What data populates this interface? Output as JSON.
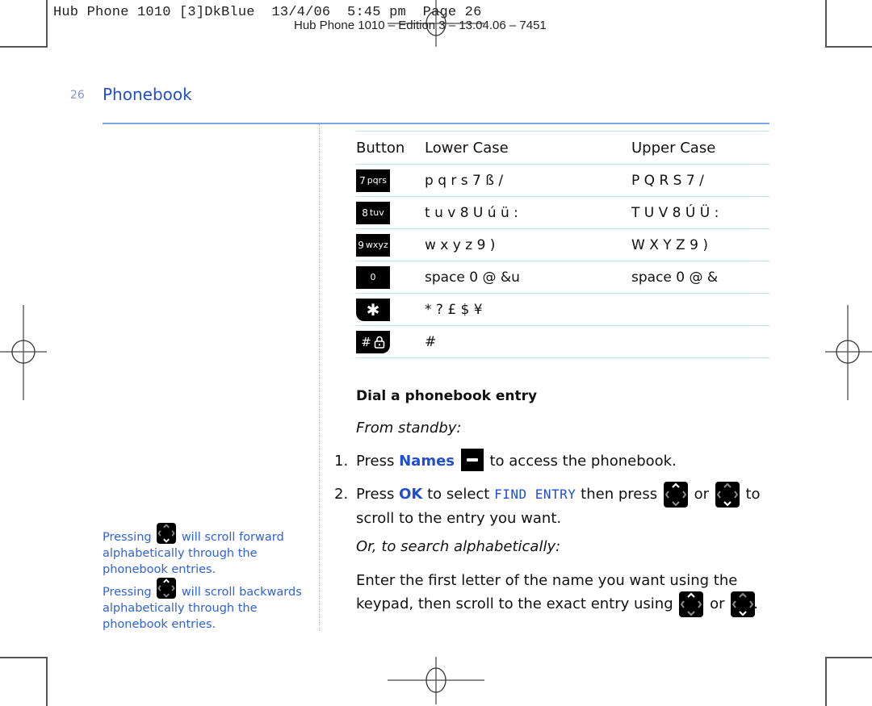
{
  "print_slug": {
    "line1": "Hub Phone 1010 [3]DkBlue  13/4/06  5:45 pm  Page 26",
    "line2": "Hub Phone 1010 – Edition 3 – 13.04.06 – 7451"
  },
  "header": {
    "page_number": "26",
    "section_title": "Phonebook"
  },
  "character_table": {
    "columns": [
      "Button",
      "Lower Case",
      "Upper Case"
    ],
    "rows": [
      {
        "key_main": "7",
        "key_sub": "pqrs",
        "lower": "p q r s 7 ß /",
        "upper": "P Q R S 7 /"
      },
      {
        "key_main": "8",
        "key_sub": "tuv",
        "lower": "t u v 8 U ú ü :",
        "upper": "T U V 8 Ú Ü :"
      },
      {
        "key_main": "9",
        "key_sub": "wxyz",
        "lower": "w x y z 9 )",
        "upper": "W X Y Z 9 )"
      },
      {
        "key_main": "0",
        "key_sub": "",
        "lower": "space 0 @ &u",
        "upper": "space 0 @ &"
      },
      {
        "key_main": "✱",
        "key_sub": "",
        "lower": "* ? £ $ ¥",
        "upper": ""
      },
      {
        "key_main": "#",
        "key_sub": "lock",
        "lower": "#",
        "upper": ""
      }
    ]
  },
  "main": {
    "heading": "Dial a phonebook entry",
    "from_standby": "From standby:",
    "step1": {
      "num": "1.",
      "pre": "Press",
      "highlight": "Names",
      "post": "to access the phonebook."
    },
    "step2": {
      "num": "2.",
      "pre": "Press",
      "highlight": "OK",
      "mid": "to select",
      "lcd": "FIND ENTRY",
      "mid2": "then press",
      "or": "or",
      "post": "to",
      "line2": "scroll to the entry you want."
    },
    "alt_heading": "Or, to search alphabetically:",
    "alt_line1": "Enter the first letter of the name you want using the",
    "alt_line2_pre": "keypad, then scroll to the exact entry using",
    "alt_or": "or",
    "alt_end": "."
  },
  "sidebar": {
    "note1": {
      "pre": "Pressing",
      "post": "will scroll forward",
      "line2": "alphabetically through the",
      "line3": "phonebook entries."
    },
    "note2": {
      "pre": "Pressing",
      "post": "will scroll backwards",
      "line2": "alphabetically through the",
      "line3": "phonebook entries."
    }
  },
  "icons": {
    "nav_down": "navigation-down-icon",
    "nav_up": "navigation-up-icon",
    "names_softkey": "left-softkey-icon",
    "keypad_lock": "keypad-lock-icon"
  },
  "colors": {
    "accent_blue": "#1f4fd0",
    "sidebar_blue": "#2e62d6",
    "rule_blue": "#7aa6e6",
    "table_rule": "#bfe0ef"
  }
}
